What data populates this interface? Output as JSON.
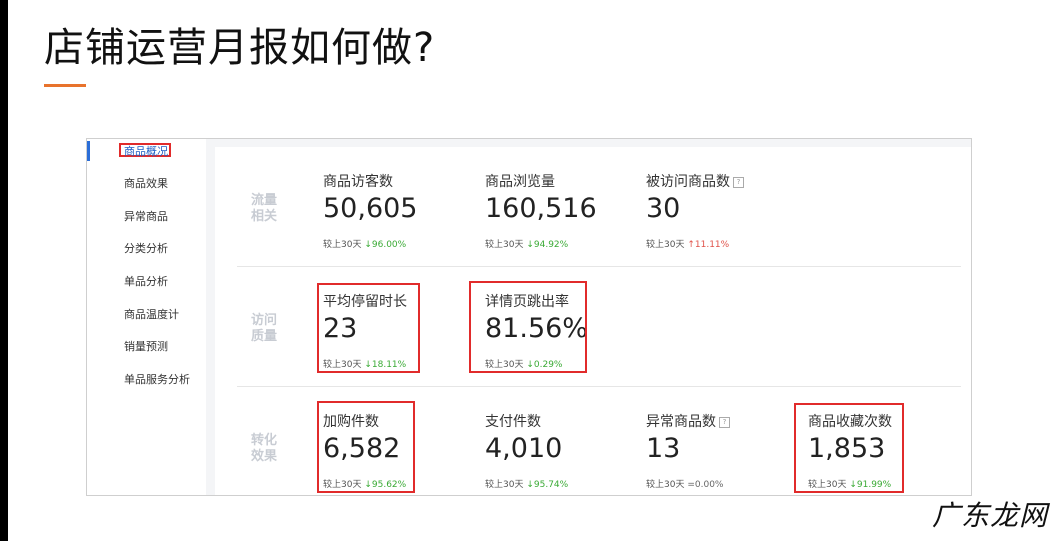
{
  "slide": {
    "title": "店铺运营月报如何做?"
  },
  "sidebar": {
    "items": [
      {
        "label": "商品概况"
      },
      {
        "label": "商品效果"
      },
      {
        "label": "异常商品"
      },
      {
        "label": "分类分析"
      },
      {
        "label": "单品分析"
      },
      {
        "label": "商品温度计"
      },
      {
        "label": "销量预测"
      },
      {
        "label": "单品服务分析"
      }
    ]
  },
  "groups": [
    {
      "label": "流量相关",
      "metrics": [
        {
          "label": "商品访客数",
          "value": "50,605",
          "cmp_label": "较上30天",
          "arrow": "↓",
          "change": "96.00%"
        },
        {
          "label": "商品浏览量",
          "value": "160,516",
          "cmp_label": "较上30天",
          "arrow": "↓",
          "change": "94.92%"
        },
        {
          "label": "被访问商品数",
          "value": "30",
          "cmp_label": "较上30天",
          "arrow": "↑",
          "change": "11.11%",
          "help": "?"
        }
      ]
    },
    {
      "label": "访问质量",
      "metrics": [
        {
          "label": "平均停留时长",
          "value": "23",
          "cmp_label": "较上30天",
          "arrow": "↓",
          "change": "18.11%"
        },
        {
          "label": "详情页跳出率",
          "value": "81.56%",
          "cmp_label": "较上30天",
          "arrow": "↓",
          "change": "0.29%"
        }
      ]
    },
    {
      "label": "转化效果",
      "metrics": [
        {
          "label": "加购件数",
          "value": "6,582",
          "cmp_label": "较上30天",
          "arrow": "↓",
          "change": "95.62%"
        },
        {
          "label": "支付件数",
          "value": "4,010",
          "cmp_label": "较上30天",
          "arrow": "↓",
          "change": "95.74%"
        },
        {
          "label": "异常商品数",
          "value": "13",
          "cmp_label": "较上30天",
          "arrow": "=",
          "change": "0.00%",
          "help": "?"
        },
        {
          "label": "商品收藏次数",
          "value": "1,853",
          "cmp_label": "较上30天",
          "arrow": "↓",
          "change": "91.99%"
        }
      ]
    }
  ],
  "watermark": {
    "text": "广东龙网"
  },
  "colors": {
    "accent": "#e8732c",
    "highlight": "#e12b2b",
    "down": "#3aaa35",
    "up": "#e0534a",
    "link": "#1f5fc5"
  }
}
